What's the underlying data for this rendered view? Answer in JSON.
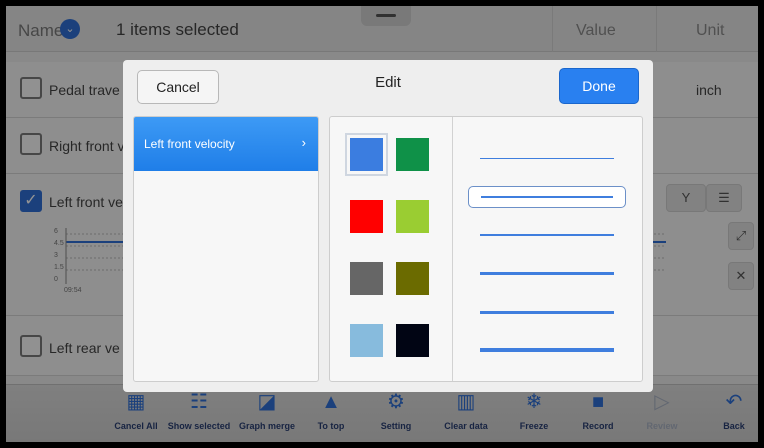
{
  "header": {
    "name_label": "Name",
    "info_icon": "info-icon",
    "selection_text": "1 items selected",
    "value_col": "Value",
    "unit_col": "Unit"
  },
  "rows": [
    {
      "label": "Pedal trave",
      "checked": false,
      "unit": "inch"
    },
    {
      "label": "Right front v",
      "checked": false
    },
    {
      "label": "Left front ve",
      "checked": true
    },
    {
      "label": "Left rear ve",
      "checked": false
    }
  ],
  "graph": {
    "ticks": [
      "6",
      "4.5",
      "3",
      "1.5",
      "0"
    ],
    "time_label": "09:54",
    "line_color": "#2f6fd6"
  },
  "row_controls": {
    "list_icon": "list-icon",
    "zoom_label": "Y",
    "zoom_icon": "zoom-y-icon",
    "expand_icon": "expand-icon",
    "close_icon": "close-icon"
  },
  "toolbar": [
    {
      "label": "Cancel All",
      "icon": "cancel-all-icon",
      "enabled": true
    },
    {
      "label": "Show selected",
      "icon": "show-selected-icon",
      "enabled": true
    },
    {
      "label": "Graph merge",
      "icon": "graph-merge-icon",
      "enabled": true
    },
    {
      "label": "To top",
      "icon": "arrow-up-icon",
      "enabled": true
    },
    {
      "label": "Setting",
      "icon": "settings-icon",
      "enabled": true
    },
    {
      "label": "Clear data",
      "icon": "trash-icon",
      "enabled": true
    },
    {
      "label": "Freeze",
      "icon": "snowflake-icon",
      "enabled": true
    },
    {
      "label": "Record",
      "icon": "video-record-icon",
      "enabled": true
    },
    {
      "label": "Review",
      "icon": "play-icon",
      "enabled": false
    },
    {
      "label": "Back",
      "icon": "back-arrow-icon",
      "enabled": true
    }
  ],
  "dialog": {
    "title": "Edit",
    "cancel_label": "Cancel",
    "done_label": "Done",
    "selected_item": "Left front velocity",
    "chevron_icon": "chevron-right-icon",
    "colors": [
      "#3b7de0",
      "#0f9148",
      "#ff0000",
      "#9acd32",
      "#666666",
      "#6b6b00",
      "#87bbdd",
      "#010514"
    ],
    "selected_color_index": 0,
    "line_styles": [
      1,
      2,
      2,
      3,
      3,
      4
    ],
    "selected_line_index": 1
  }
}
